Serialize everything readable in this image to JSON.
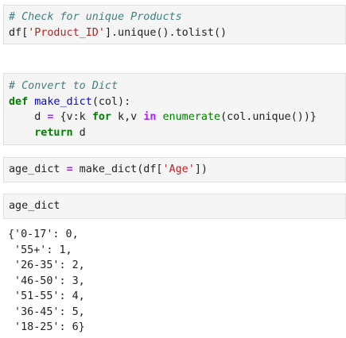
{
  "cells": [
    {
      "lines": [
        {
          "comment": "# Check for unique Products"
        },
        {
          "pre": "df[",
          "str": "'Product_ID'",
          "post": "].unique().tolist()"
        }
      ]
    },
    {
      "lines": [
        {
          "comment": "# Convert to Dict"
        },
        {
          "kw": "def",
          "fn": "make_dict",
          "rest": "(col):"
        },
        {
          "indent": "    ",
          "a": "d ",
          "op": "=",
          "b": " {v:k ",
          "kw1": "for",
          "c": " k,v ",
          "kw2": "in",
          "d": " ",
          "bi": "enumerate",
          "e": "(col.unique())}"
        },
        {
          "indent": "    ",
          "kw": "return",
          "rest": " d"
        }
      ]
    },
    {
      "lines": [
        {
          "a": "age_dict ",
          "op": "=",
          "b": " make_dict(df[",
          "str": "'Age'",
          "c": "])"
        }
      ]
    },
    {
      "lines": [
        {
          "text": "age_dict"
        }
      ]
    }
  ],
  "output": {
    "lines": [
      "{'0-17': 0,",
      " '55+': 1,",
      " '26-35': 2,",
      " '46-50': 3,",
      " '51-55': 4,",
      " '36-45': 5,",
      " '18-25': 6}"
    ]
  }
}
